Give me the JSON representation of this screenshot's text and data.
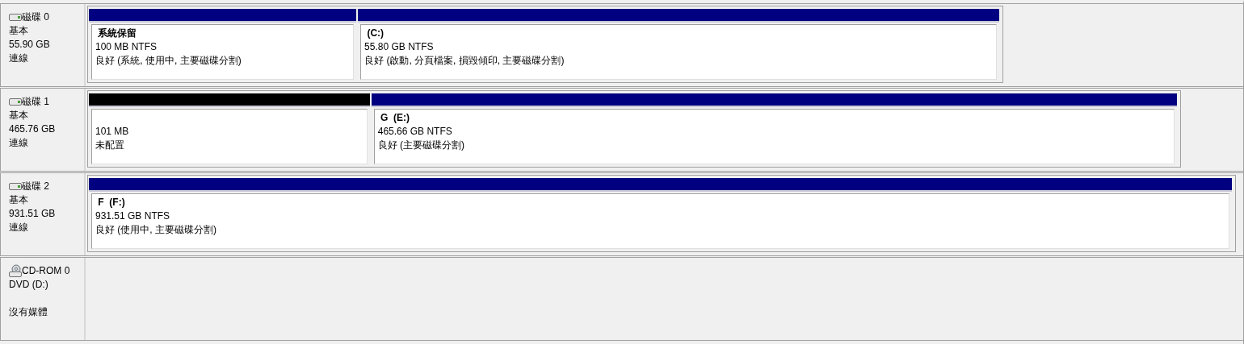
{
  "disks": [
    {
      "kind": "disk",
      "name": "磁碟 0",
      "lines": [
        "基本",
        "55.90 GB",
        "連線"
      ],
      "partitions": [
        {
          "kind": "primary",
          "name": "系統保留",
          "size": "100 MB NTFS",
          "status": "良好 (系統, 使用中, 主要磁碟分割)"
        },
        {
          "kind": "primary",
          "name": "(C:)",
          "size": "55.80 GB NTFS",
          "status": "良好 (啟動, 分頁檔案, 損毀傾印, 主要磁碟分割)"
        }
      ]
    },
    {
      "kind": "disk",
      "name": "磁碟 1",
      "lines": [
        "基本",
        "465.76 GB",
        "連線"
      ],
      "partitions": [
        {
          "kind": "unallocated",
          "size": "101 MB",
          "status": "未配置"
        },
        {
          "kind": "primary",
          "name": "G  (E:)",
          "size": "465.66 GB NTFS",
          "status": "良好 (主要磁碟分割)"
        }
      ]
    },
    {
      "kind": "disk",
      "name": "磁碟 2",
      "lines": [
        "基本",
        "931.51 GB",
        "連線"
      ],
      "partitions": [
        {
          "kind": "primary",
          "name": "F  (F:)",
          "size": "931.51 GB NTFS",
          "status": "良好 (使用中, 主要磁碟分割)"
        }
      ]
    },
    {
      "kind": "cdrom",
      "name": "CD-ROM 0",
      "lines": [
        "DVD (D:)",
        "沒有媒體"
      ]
    }
  ]
}
